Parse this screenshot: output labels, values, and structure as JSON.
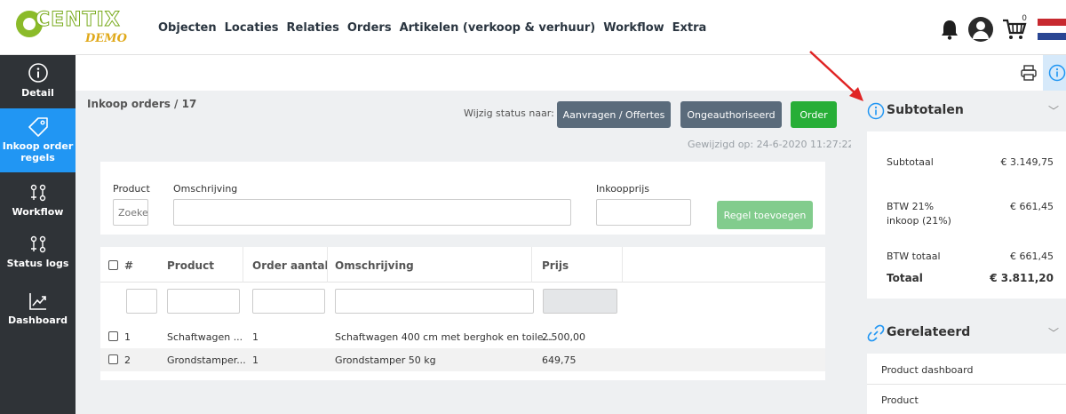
{
  "brand": {
    "name": "CENTIX",
    "sub": "DEMO"
  },
  "nav": [
    "Objecten",
    "Locaties",
    "Relaties",
    "Orders",
    "Artikelen (verkoop & verhuur)",
    "Workflow",
    "Extra"
  ],
  "header": {
    "cart_count": "0"
  },
  "sidebar": {
    "items": [
      {
        "label": "Detail",
        "icon": "info-icon"
      },
      {
        "label": "Inkoop order regels",
        "icon": "tag-icon"
      },
      {
        "label": "Workflow",
        "icon": "workflow-icon"
      },
      {
        "label": "Status logs",
        "icon": "workflow-icon"
      },
      {
        "label": "Dashboard",
        "icon": "chart-icon"
      }
    ]
  },
  "page": {
    "breadcrumb": "Inkoop orders /  17",
    "status_label": "Wijzig status naar:",
    "status_buttons": [
      "Aanvragen / Offertes",
      "Ongeauthoriseerd",
      "Order"
    ],
    "modified": "Gewijzigd op: 24-6-2020 11:27:22"
  },
  "form": {
    "product_label": "Product",
    "product_placeholder": "Zoeken",
    "description_label": "Omschrijving",
    "price_label": "Inkoopprijs",
    "add_button": "Regel toevoegen"
  },
  "table": {
    "headers": [
      "#",
      "Product",
      "Order aantal",
      "Omschrijving",
      "Prijs"
    ],
    "rows": [
      {
        "num": "1",
        "product": "Schaftwagen ...",
        "qty": "1",
        "description": "Schaftwagen 400 cm met berghok en toile...",
        "price": "2.500,00"
      },
      {
        "num": "2",
        "product": "Grondstamper...",
        "qty": "1",
        "description": "Grondstamper 50 kg",
        "price": "649,75"
      }
    ]
  },
  "subtotals": {
    "title": "Subtotalen",
    "rows": [
      {
        "label": "Subtotaal",
        "value": "€ 3.149,75"
      },
      {
        "label": "BTW 21%",
        "label2": "inkoop (21%)",
        "value": "€ 661,45"
      },
      {
        "label": "BTW totaal",
        "value": "€ 661,45"
      },
      {
        "label": "Totaal",
        "value": "€ 3.811,20"
      }
    ]
  },
  "related": {
    "title": "Gerelateerd",
    "links": [
      "Product dashboard",
      "Product"
    ]
  },
  "colors": {
    "sidebar_bg": "#2f3337",
    "accent_blue": "#2196f3",
    "button_gray": "#5a6b7b",
    "button_green": "#27ae37",
    "arrow_red": "#e02424"
  }
}
